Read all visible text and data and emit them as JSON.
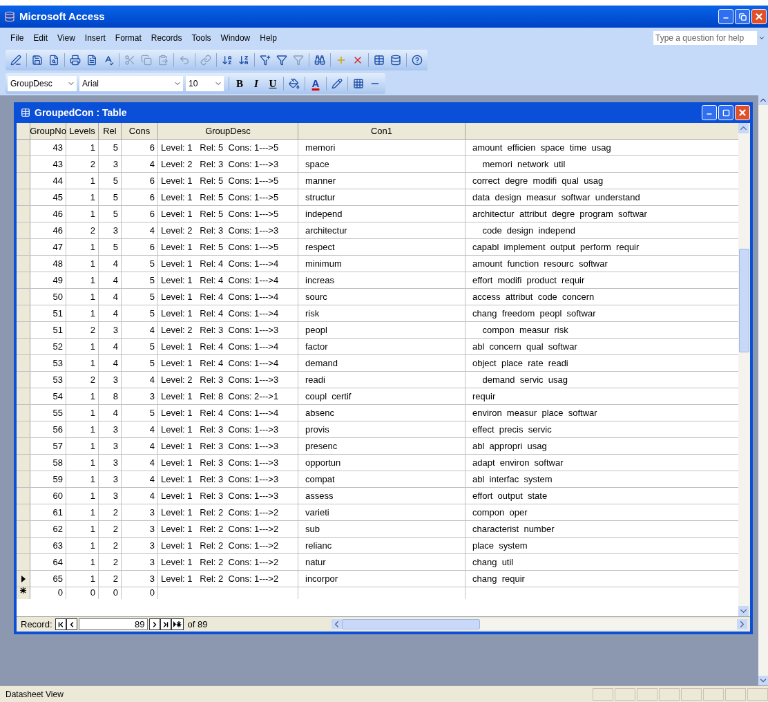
{
  "window": {
    "title": "Microsoft Access"
  },
  "menu": [
    {
      "label": "File"
    },
    {
      "label": "Edit"
    },
    {
      "label": "View"
    },
    {
      "label": "Insert"
    },
    {
      "label": "Format"
    },
    {
      "label": "Records"
    },
    {
      "label": "Tools"
    },
    {
      "label": "Window"
    },
    {
      "label": "Help"
    }
  ],
  "help_box": {
    "placeholder": "Type a question for help"
  },
  "formatting": {
    "field": "GroupDesc",
    "font": "Arial",
    "size": "10",
    "bold": "B",
    "italic": "I",
    "underline": "U",
    "font_color": "A"
  },
  "table_window": {
    "title": "GroupedCon : Table",
    "columns": [
      "GroupNo",
      "Levels",
      "Rel",
      "Cons",
      "GroupDesc",
      "Con1"
    ],
    "rows": [
      {
        "group_no": "43",
        "levels": "1",
        "rel": "5",
        "cons": "6",
        "group_desc": "Level: 1   Rel: 5  Cons: 1--->5",
        "con1": "memori",
        "column_7": "amount  efficien  space  time  usag",
        "current": false
      },
      {
        "group_no": "43",
        "levels": "2",
        "rel": "3",
        "cons": "4",
        "group_desc": "Level: 2   Rel: 3  Cons: 1--->3",
        "con1": "space",
        "column_7": "    memori  network  util",
        "current": false
      },
      {
        "group_no": "44",
        "levels": "1",
        "rel": "5",
        "cons": "6",
        "group_desc": "Level: 1   Rel: 5  Cons: 1--->5",
        "con1": "manner",
        "column_7": "correct  degre  modifi  qual  usag",
        "current": false
      },
      {
        "group_no": "45",
        "levels": "1",
        "rel": "5",
        "cons": "6",
        "group_desc": "Level: 1   Rel: 5  Cons: 1--->5",
        "con1": "structur",
        "column_7": "data  design  measur  softwar  understand",
        "current": false
      },
      {
        "group_no": "46",
        "levels": "1",
        "rel": "5",
        "cons": "6",
        "group_desc": "Level: 1   Rel: 5  Cons: 1--->5",
        "con1": "independ",
        "column_7": "architectur  attribut  degre  program  softwar",
        "current": false
      },
      {
        "group_no": "46",
        "levels": "2",
        "rel": "3",
        "cons": "4",
        "group_desc": "Level: 2   Rel: 3  Cons: 1--->3",
        "con1": "architectur",
        "column_7": "    code  design  independ",
        "current": false
      },
      {
        "group_no": "47",
        "levels": "1",
        "rel": "5",
        "cons": "6",
        "group_desc": "Level: 1   Rel: 5  Cons: 1--->5",
        "con1": "respect",
        "column_7": "capabl  implement  output  perform  requir",
        "current": false
      },
      {
        "group_no": "48",
        "levels": "1",
        "rel": "4",
        "cons": "5",
        "group_desc": "Level: 1   Rel: 4  Cons: 1--->4",
        "con1": "minimum",
        "column_7": "amount  function  resourc  softwar",
        "current": false
      },
      {
        "group_no": "49",
        "levels": "1",
        "rel": "4",
        "cons": "5",
        "group_desc": "Level: 1   Rel: 4  Cons: 1--->4",
        "con1": "increas",
        "column_7": "effort  modifi  product  requir",
        "current": false
      },
      {
        "group_no": "50",
        "levels": "1",
        "rel": "4",
        "cons": "5",
        "group_desc": "Level: 1   Rel: 4  Cons: 1--->4",
        "con1": "sourc",
        "column_7": "access  attribut  code  concern",
        "current": false
      },
      {
        "group_no": "51",
        "levels": "1",
        "rel": "4",
        "cons": "5",
        "group_desc": "Level: 1   Rel: 4  Cons: 1--->4",
        "con1": "risk",
        "column_7": "chang  freedom  peopl  softwar",
        "current": false
      },
      {
        "group_no": "51",
        "levels": "2",
        "rel": "3",
        "cons": "4",
        "group_desc": "Level: 2   Rel: 3  Cons: 1--->3",
        "con1": "peopl",
        "column_7": "    compon  measur  risk",
        "current": false
      },
      {
        "group_no": "52",
        "levels": "1",
        "rel": "4",
        "cons": "5",
        "group_desc": "Level: 1   Rel: 4  Cons: 1--->4",
        "con1": "factor",
        "column_7": "abl  concern  qual  softwar",
        "current": false
      },
      {
        "group_no": "53",
        "levels": "1",
        "rel": "4",
        "cons": "5",
        "group_desc": "Level: 1   Rel: 4  Cons: 1--->4",
        "con1": "demand",
        "column_7": "object  place  rate  readi",
        "current": false
      },
      {
        "group_no": "53",
        "levels": "2",
        "rel": "3",
        "cons": "4",
        "group_desc": "Level: 2   Rel: 3  Cons: 1--->3",
        "con1": "readi",
        "column_7": "    demand  servic  usag",
        "current": false
      },
      {
        "group_no": "54",
        "levels": "1",
        "rel": "8",
        "cons": "3",
        "group_desc": "Level: 1   Rel: 8  Cons: 2--->1",
        "con1": "coupl  certif",
        "column_7": "requir",
        "current": false
      },
      {
        "group_no": "55",
        "levels": "1",
        "rel": "4",
        "cons": "5",
        "group_desc": "Level: 1   Rel: 4  Cons: 1--->4",
        "con1": "absenc",
        "column_7": "environ  measur  place  softwar",
        "current": false
      },
      {
        "group_no": "56",
        "levels": "1",
        "rel": "3",
        "cons": "4",
        "group_desc": "Level: 1   Rel: 3  Cons: 1--->3",
        "con1": "provis",
        "column_7": "effect  precis  servic",
        "current": false
      },
      {
        "group_no": "57",
        "levels": "1",
        "rel": "3",
        "cons": "4",
        "group_desc": "Level: 1   Rel: 3  Cons: 1--->3",
        "con1": "presenc",
        "column_7": "abl  appropri  usag",
        "current": false
      },
      {
        "group_no": "58",
        "levels": "1",
        "rel": "3",
        "cons": "4",
        "group_desc": "Level: 1   Rel: 3  Cons: 1--->3",
        "con1": "opportun",
        "column_7": "adapt  environ  softwar",
        "current": false
      },
      {
        "group_no": "59",
        "levels": "1",
        "rel": "3",
        "cons": "4",
        "group_desc": "Level: 1   Rel: 3  Cons: 1--->3",
        "con1": "compat",
        "column_7": "abl  interfac  system",
        "current": false
      },
      {
        "group_no": "60",
        "levels": "1",
        "rel": "3",
        "cons": "4",
        "group_desc": "Level: 1   Rel: 3  Cons: 1--->3",
        "con1": "assess",
        "column_7": "effort  output  state",
        "current": false
      },
      {
        "group_no": "61",
        "levels": "1",
        "rel": "2",
        "cons": "3",
        "group_desc": "Level: 1   Rel: 2  Cons: 1--->2",
        "con1": "varieti",
        "column_7": "compon  oper",
        "current": false
      },
      {
        "group_no": "62",
        "levels": "1",
        "rel": "2",
        "cons": "3",
        "group_desc": "Level: 1   Rel: 2  Cons: 1--->2",
        "con1": "sub",
        "column_7": "characterist  number",
        "current": false
      },
      {
        "group_no": "63",
        "levels": "1",
        "rel": "2",
        "cons": "3",
        "group_desc": "Level: 1   Rel: 2  Cons: 1--->2",
        "con1": "relianc",
        "column_7": "place  system",
        "current": false
      },
      {
        "group_no": "64",
        "levels": "1",
        "rel": "2",
        "cons": "3",
        "group_desc": "Level: 1   Rel: 2  Cons: 1--->2",
        "con1": "natur",
        "column_7": "chang  util",
        "current": false
      },
      {
        "group_no": "65",
        "levels": "1",
        "rel": "2",
        "cons": "3",
        "group_desc": "Level: 1   Rel: 2  Cons: 1--->2",
        "con1": "incorpor",
        "column_7": "chang  requir",
        "current": true
      }
    ],
    "new_row": {
      "group_no": "0",
      "levels": "0",
      "rel": "0",
      "cons": "0"
    },
    "record_bar": {
      "label": "Record:",
      "current": "89",
      "total": "of 89"
    }
  },
  "status_bar": {
    "text": "Datasheet View"
  }
}
